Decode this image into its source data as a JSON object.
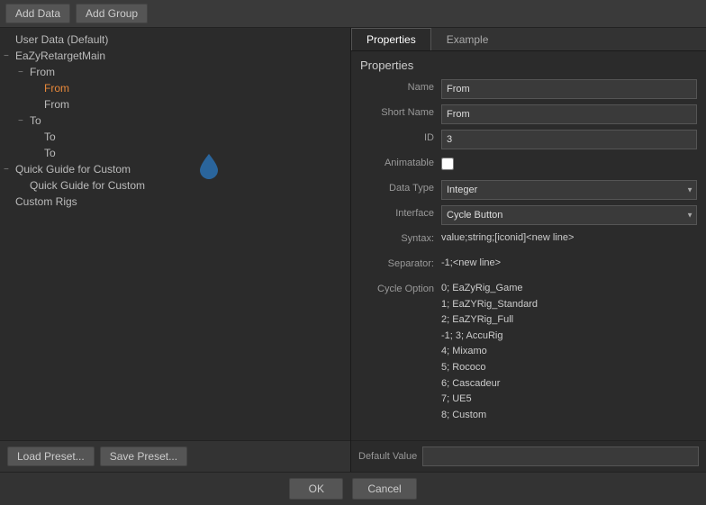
{
  "toolbar": {
    "add_data_label": "Add Data",
    "add_group_label": "Add Group"
  },
  "tree": {
    "items": [
      {
        "id": "user-data",
        "label": "User Data (Default)",
        "level": 0,
        "icon": ""
      },
      {
        "id": "eazy-retarget-main",
        "label": "EaZyRetargetMain",
        "level": 0,
        "icon": "−"
      },
      {
        "id": "from-group",
        "label": "From",
        "level": 1,
        "icon": "−"
      },
      {
        "id": "from-orange",
        "label": "From",
        "level": 2,
        "icon": "",
        "orange": true
      },
      {
        "id": "from-plain",
        "label": "From",
        "level": 2,
        "icon": ""
      },
      {
        "id": "to-group",
        "label": "To",
        "level": 1,
        "icon": "−"
      },
      {
        "id": "to-orange",
        "label": "To",
        "level": 2,
        "icon": "",
        "orange": false
      },
      {
        "id": "to-plain",
        "label": "To",
        "level": 2,
        "icon": ""
      },
      {
        "id": "quick-guide-group",
        "label": "Quick Guide for Custom",
        "level": 0,
        "icon": "−"
      },
      {
        "id": "quick-guide-item",
        "label": "Quick Guide for Custom",
        "level": 1,
        "icon": ""
      },
      {
        "id": "custom-rigs",
        "label": "Custom Rigs",
        "level": 0,
        "icon": ""
      }
    ]
  },
  "tabs": [
    {
      "id": "properties",
      "label": "Properties",
      "active": true
    },
    {
      "id": "example",
      "label": "Example",
      "active": false
    }
  ],
  "properties": {
    "title": "Properties",
    "fields": {
      "name_label": "Name",
      "name_value": "From",
      "short_name_label": "Short Name",
      "short_name_value": "From",
      "id_label": "ID",
      "id_value": "3",
      "animatable_label": "Animatable",
      "data_type_label": "Data Type",
      "data_type_value": "Integer",
      "interface_label": "Interface",
      "interface_value": "Cycle Button",
      "syntax_label": "Syntax:",
      "syntax_value": "value;string;[iconid]<new line>",
      "separator_label": "Separator:",
      "separator_value": "-1;<new line>",
      "cycle_option_label": "Cycle Option",
      "cycle_options": [
        "0; EaZyRig_Game",
        "1; EaZYRig_Standard",
        "2; EaZYRig_Full",
        "-1; 3; AccuRig",
        "4; Mixamo",
        "5; Rococo",
        "6; Cascadeur",
        "7; UE5",
        "8; Custom"
      ],
      "default_value_label": "Default Value",
      "default_value": ""
    }
  },
  "bottom_left": {
    "load_preset_label": "Load Preset...",
    "save_preset_label": "Save Preset..."
  },
  "ok_cancel": {
    "ok_label": "OK",
    "cancel_label": "Cancel"
  }
}
